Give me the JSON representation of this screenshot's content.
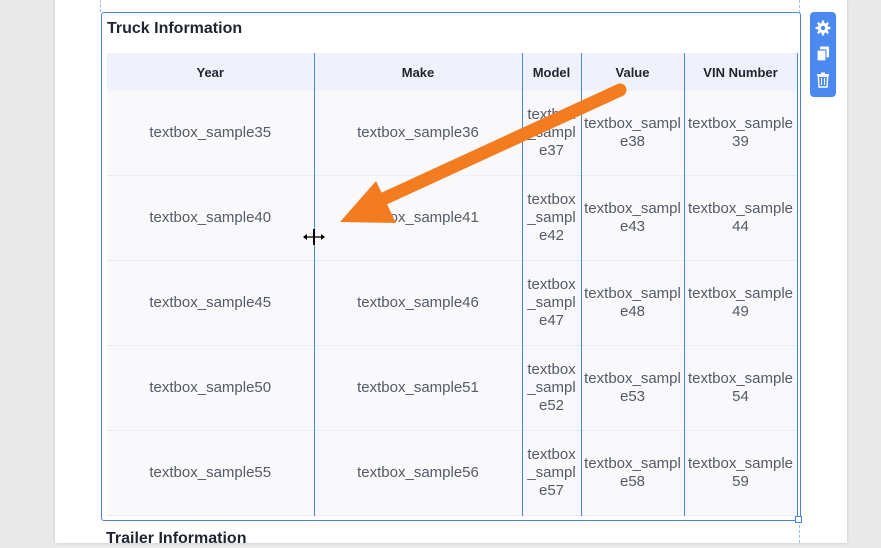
{
  "section": {
    "title": "Truck Information",
    "columns": [
      "Year",
      "Make",
      "Model",
      "Value",
      "VIN Number"
    ],
    "rows": [
      [
        "textbox_sample35",
        "textbox_sample36",
        "textbox_sample37",
        "textbox_sample38",
        "textbox_sample39"
      ],
      [
        "textbox_sample40",
        "textbox_sample41",
        "textbox_sample42",
        "textbox_sample43",
        "textbox_sample44"
      ],
      [
        "textbox_sample45",
        "textbox_sample46",
        "textbox_sample47",
        "textbox_sample48",
        "textbox_sample49"
      ],
      [
        "textbox_sample50",
        "textbox_sample51",
        "textbox_sample52",
        "textbox_sample53",
        "textbox_sample54"
      ],
      [
        "textbox_sample55",
        "textbox_sample56",
        "textbox_sample57",
        "textbox_sample58",
        "textbox_sample59"
      ]
    ]
  },
  "next_section": {
    "title": "Trailer Information"
  },
  "toolbar": {
    "icons": [
      "gear-icon",
      "copy-icon",
      "trash-icon"
    ]
  },
  "colors": {
    "accent": "#4a8af0",
    "border": "#4a86d6",
    "arrow": "#f47c20",
    "header_bg": "#eff1fb"
  }
}
